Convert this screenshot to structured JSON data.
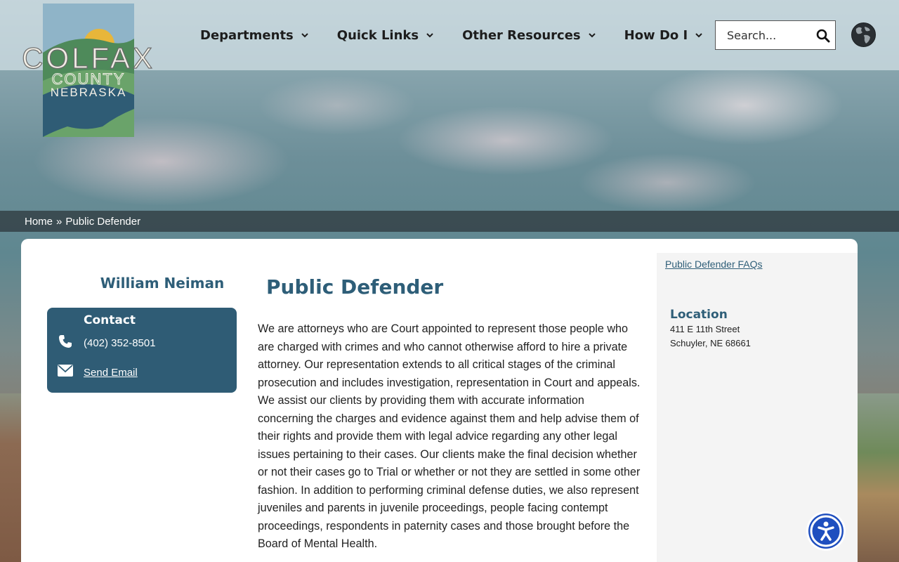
{
  "brand": {
    "name": "COLFAX",
    "county": "COUNTY",
    "state": "NEBRASKA",
    "colors": {
      "primary": "#2f5c75",
      "title": "#2e5e78",
      "sun": "#e8b63a",
      "green": "#4e8a5a"
    }
  },
  "nav": {
    "items": [
      {
        "label": "Departments",
        "icon": "chevron-down-icon"
      },
      {
        "label": "Quick Links",
        "icon": "chevron-down-icon"
      },
      {
        "label": "Other Resources",
        "icon": "chevron-down-icon"
      },
      {
        "label": "How Do I",
        "icon": "chevron-down-icon"
      }
    ]
  },
  "search": {
    "placeholder": "Search...",
    "icon": "search-icon"
  },
  "language": {
    "icon": "globe-icon"
  },
  "breadcrumb": {
    "home": "Home",
    "separator": "»",
    "current": "Public Defender"
  },
  "person": {
    "name": "William Neiman"
  },
  "contact": {
    "title": "Contact",
    "phone": "(402) 352-8501",
    "phone_icon": "phone-icon",
    "email_label": "Send Email",
    "email_icon": "envelope-icon"
  },
  "page": {
    "title": "Public Defender",
    "body": "We are attorneys who are Court appointed to represent those people who are charged with crimes and who cannot otherwise afford to hire a private attorney. Our representation extends to all critical stages of the criminal prosecution and includes investigation, representation in Court and appeals. We assist our clients by providing them with accurate information concerning the charges and evidence against them and help advise them of their rights and provide them with legal advice regarding any other legal issues pertaining to their cases. Our clients make the final decision whether or not their cases go to Trial or whether or not they are settled in some other fashion. In addition to performing criminal defense duties, we also represent juveniles and parents in juvenile proceedings, people facing contempt proceedings, respondents in paternity cases and those brought before the Board of Mental Health."
  },
  "sidebar": {
    "faq_link": "Public Defender FAQs",
    "location_title": "Location",
    "address_line1": "411 E 11th Street",
    "address_line2": "Schuyler, NE 68661"
  },
  "accessibility": {
    "icon": "accessibility-icon"
  }
}
